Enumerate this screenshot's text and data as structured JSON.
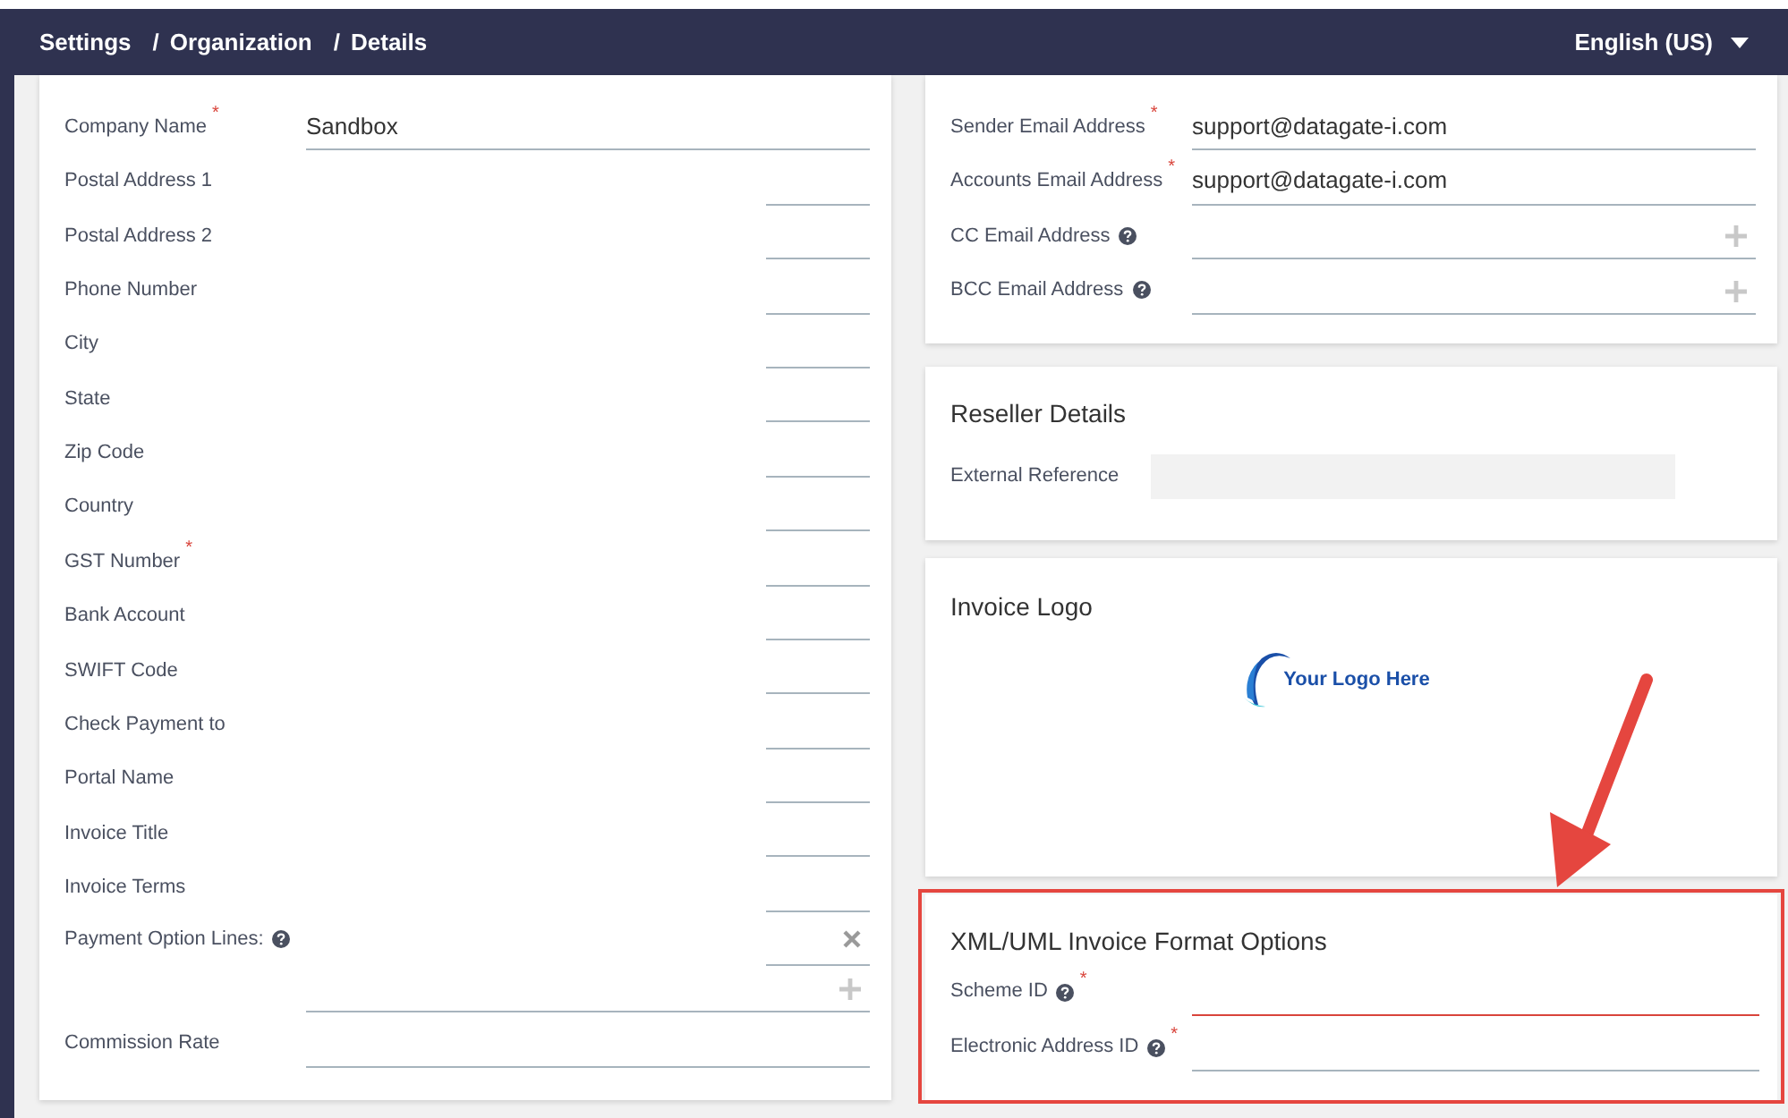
{
  "breadcrumb": [
    {
      "label": "Settings"
    },
    {
      "label": "Organization"
    },
    {
      "label": "Details"
    }
  ],
  "breadcrumb_separator": "/",
  "language": {
    "label": "English (US)"
  },
  "organization_fields": [
    {
      "label": "Company Name",
      "required_mark": "*",
      "help": false,
      "kind": "wide",
      "value": "Sandbox"
    },
    {
      "label": "Postal Address 1",
      "help": false,
      "kind": "short"
    },
    {
      "label": "Postal Address 2",
      "help": false,
      "kind": "short"
    },
    {
      "label": "Phone Number",
      "help": false,
      "kind": "short"
    },
    {
      "label": "City",
      "help": false,
      "kind": "short"
    },
    {
      "label": "State",
      "help": false,
      "kind": "short"
    },
    {
      "label": "Zip Code",
      "help": false,
      "kind": "short"
    },
    {
      "label": "Country",
      "help": false,
      "kind": "short"
    },
    {
      "label": "GST Number",
      "required_mark": "*",
      "help": false,
      "kind": "short"
    },
    {
      "label": "Bank Account",
      "help": false,
      "kind": "short"
    },
    {
      "label": "SWIFT Code",
      "help": false,
      "kind": "short"
    },
    {
      "label": "Check Payment to",
      "help": false,
      "kind": "short"
    },
    {
      "label": "Portal Name",
      "help": false,
      "kind": "short"
    },
    {
      "label": "Invoice Title",
      "help": false,
      "kind": "short"
    },
    {
      "label": "Invoice Terms",
      "help": false,
      "kind": "short"
    },
    {
      "label": "Payment Option Lines:",
      "help": true,
      "kind": "lines"
    },
    {
      "label": "Commission Rate",
      "help": false,
      "kind": "wide"
    }
  ],
  "email_fields": [
    {
      "label": "Sender Email Address",
      "required_mark": "*",
      "help": false,
      "kind": "text",
      "value": "support@datagate-i.com"
    },
    {
      "label": "Accounts Email Address",
      "required_mark": "*",
      "help": false,
      "kind": "text",
      "value": "support@datagate-i.com"
    },
    {
      "label": "CC Email Address",
      "help": true,
      "kind": "add"
    },
    {
      "label": "BCC Email Address",
      "help": true,
      "kind": "add"
    }
  ],
  "reseller": {
    "title": "Reseller Details",
    "fields": [
      {
        "label": "External Reference",
        "kind": "readonly"
      }
    ]
  },
  "invoice_logo": {
    "title": "Invoice Logo",
    "logo_text": "Your Logo Here"
  },
  "format_options": {
    "title": "XML/UML Invoice Format Options",
    "fields": [
      {
        "label": "Scheme ID",
        "required_mark": "*",
        "help": true,
        "invalid": true
      },
      {
        "label": "Electronic Address ID",
        "required_mark": "*",
        "help": true,
        "invalid": false
      }
    ]
  }
}
